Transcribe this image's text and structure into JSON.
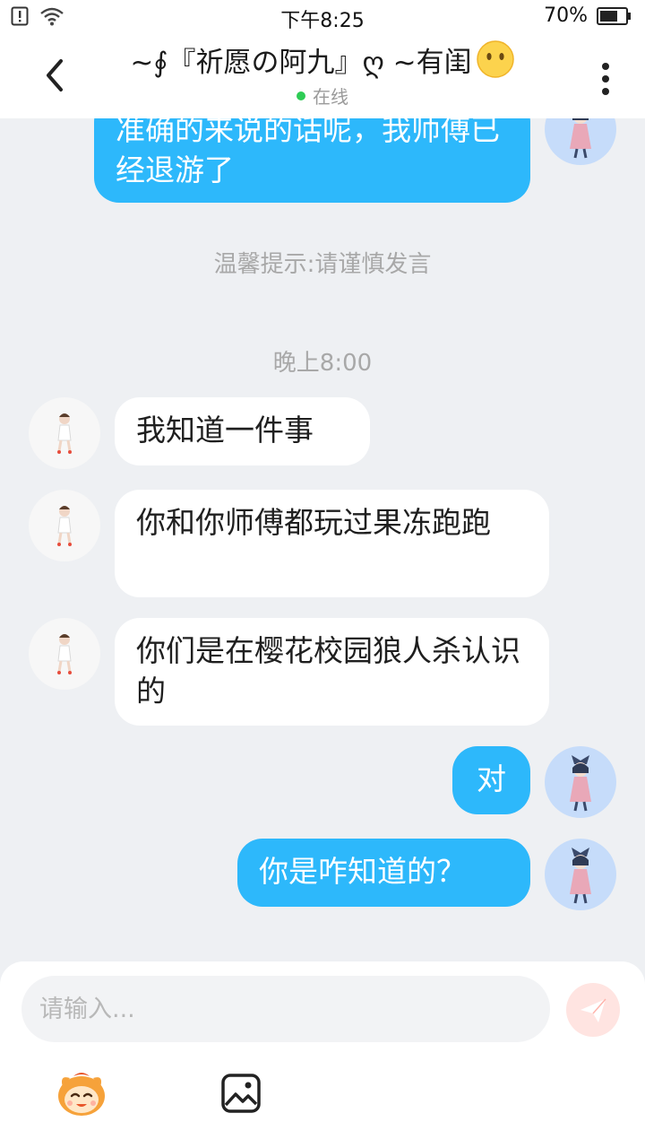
{
  "status_bar": {
    "time": "下午8:25",
    "battery": "70%",
    "battery_level": 0.7
  },
  "header": {
    "title": "~∮『祈愿の阿九』ღ ~有闺",
    "status": "在线"
  },
  "messages": [
    {
      "side": "out",
      "text": "准确的来说的话呢，我师傅已经退游了"
    },
    {
      "type": "system",
      "text": "温馨提示:请谨慎发言"
    },
    {
      "type": "time",
      "text": "晚上8:00"
    },
    {
      "side": "in",
      "text": "我知道一件事"
    },
    {
      "side": "in",
      "text": "你和你师傅都玩过果冻跑跑"
    },
    {
      "side": "in",
      "text": "你们是在樱花校园狼人杀认识的"
    },
    {
      "side": "out",
      "text": "对"
    },
    {
      "side": "out",
      "text": "你是咋知道的？"
    }
  ],
  "input": {
    "placeholder": "请输入..."
  },
  "colors": {
    "outgoing_bubble": "#2db8fb",
    "incoming_bubble": "#ffffff",
    "background": "#eef0f3",
    "online_dot": "#2ecc55",
    "send_button": "#ffe4e1"
  },
  "icons": [
    "back-arrow-icon",
    "more-vertical-icon",
    "neutral-face-emoji-icon",
    "send-icon",
    "emoji-mascot-icon",
    "image-icon",
    "wifi-icon",
    "battery-icon"
  ]
}
